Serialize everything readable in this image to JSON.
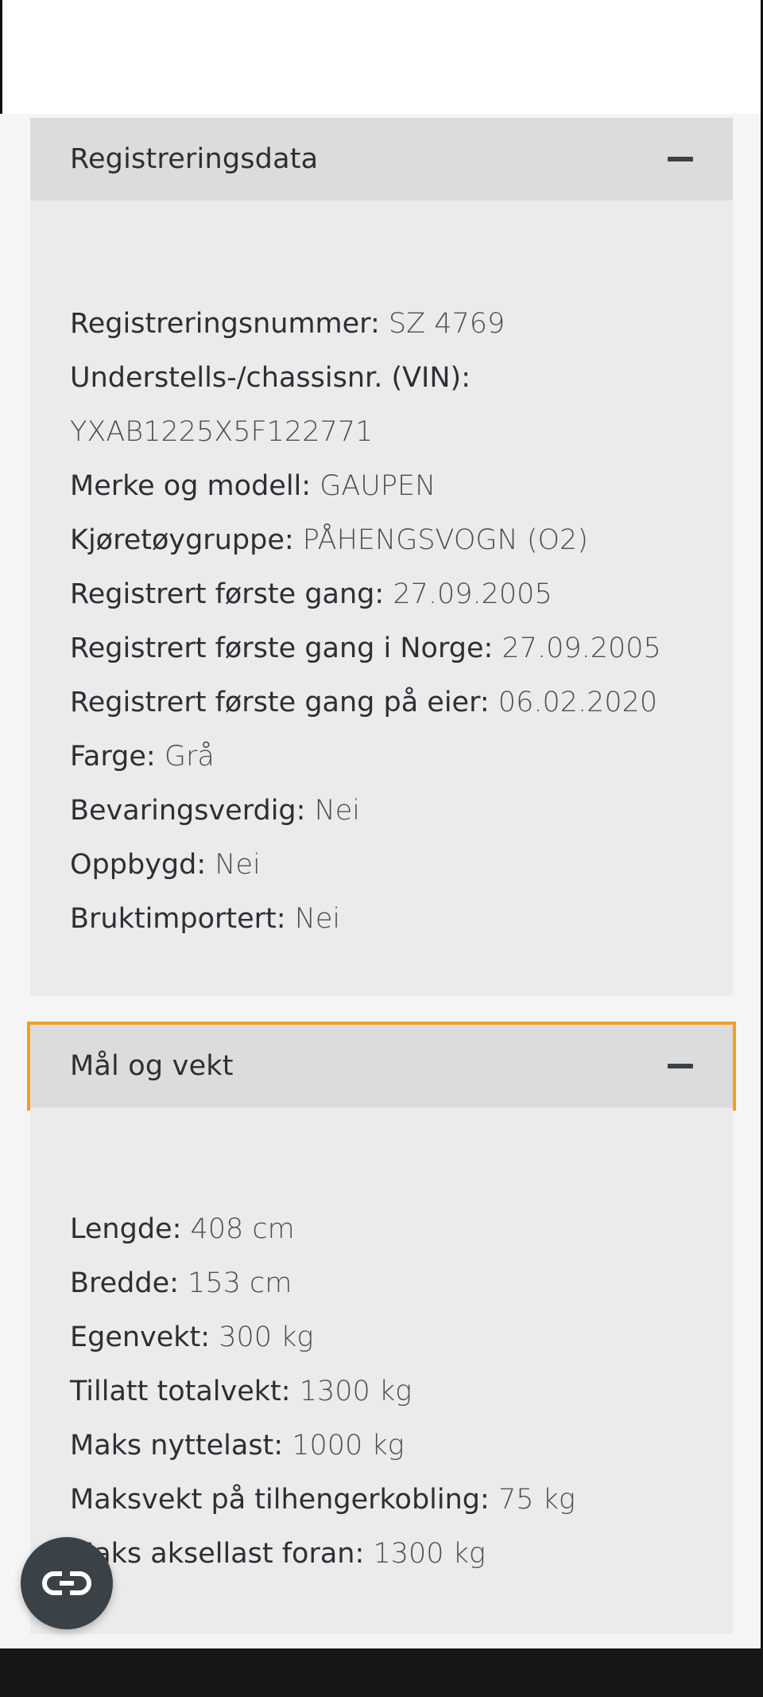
{
  "sections": {
    "registration": {
      "title": "Registreringsdata",
      "rows": [
        {
          "label": "Registreringsnummer:",
          "value": "SZ 4769"
        },
        {
          "label": "Understells-/chassisnr. (VIN):",
          "value": ""
        },
        {
          "label": "",
          "value": "YXAB1225X5F122771"
        },
        {
          "label": "Merke og modell:",
          "value": "GAUPEN"
        },
        {
          "label": "Kjøretøygruppe:",
          "value": "PÅHENGSVOGN (O2)"
        },
        {
          "label": "Registrert første gang:",
          "value": "27.09.2005"
        },
        {
          "label": "Registrert første gang i Norge:",
          "value": "27.09.2005"
        },
        {
          "label": "Registrert første gang på eier:",
          "value": "06.02.2020"
        },
        {
          "label": "Farge:",
          "value": "Grå"
        },
        {
          "label": "Bevaringsverdig:",
          "value": "Nei"
        },
        {
          "label": "Oppbygd:",
          "value": "Nei"
        },
        {
          "label": "Bruktimportert:",
          "value": "Nei"
        }
      ]
    },
    "dimensions": {
      "title": "Mål og vekt",
      "rows": [
        {
          "label": "Lengde:",
          "value": "408 cm"
        },
        {
          "label": "Bredde:",
          "value": "153 cm"
        },
        {
          "label": "Egenvekt:",
          "value": "300 kg"
        },
        {
          "label": "Tillatt totalvekt:",
          "value": "1300 kg"
        },
        {
          "label": "Maks nyttelast:",
          "value": "1000 kg"
        },
        {
          "label": "Maksvekt på tilhengerkobling:",
          "value": "75 kg"
        },
        {
          "label": "Maks aksellast foran:",
          "value": "1300 kg"
        }
      ]
    }
  },
  "icons": {
    "collapse": "minus-icon",
    "fab": "link-icon"
  },
  "colors": {
    "focus_outline": "#f0a020",
    "header_bg": "#dcdcdc",
    "body_bg": "#ebebeb",
    "fab_bg": "#3b4247"
  }
}
